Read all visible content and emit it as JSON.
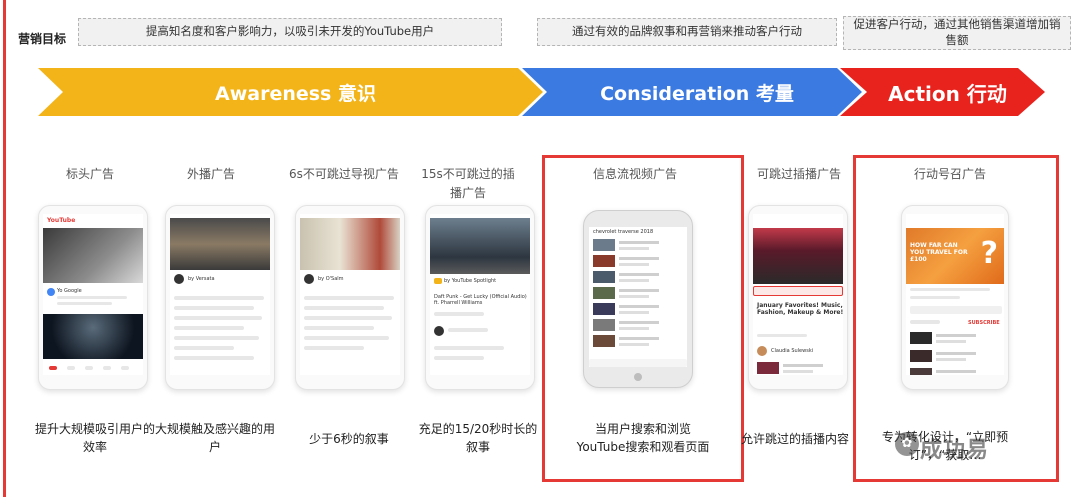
{
  "goals": {
    "label": "营销目标",
    "awareness_goal": "提高知名度和客户影响力，以吸引未开发的YouTube用户",
    "consideration_goal": "通过有效的品牌叙事和再营销来推动客户行动",
    "action_goal": "促进客户行动，通过其他销售渠道增加销售额"
  },
  "stages": {
    "awareness": "Awareness 意识",
    "consideration": "Consideration 考量",
    "action": "Action 行动"
  },
  "columns": [
    {
      "title": "标头广告",
      "caption": "提升大规模吸引用户的效率"
    },
    {
      "title": "外播广告",
      "caption": "大规模触及感兴趣的用户"
    },
    {
      "title": "6s不可跳过导视广告",
      "caption": "少于6秒的叙事"
    },
    {
      "title": "15s不可跳过的插播广告",
      "caption": "充足的15/20秒时长的叙事"
    },
    {
      "title": "信息流视频广告",
      "caption": "当用户搜索和浏览YouTube搜索和观看页面"
    },
    {
      "title": "可跳过插播广告",
      "caption": "允许跳过的插播内容"
    },
    {
      "title": "行动号召广告",
      "caption": "专为转化设计，“立即预订”，“获取…"
    }
  ],
  "mockups": {
    "masthead_brand": "YouTube",
    "masthead_sponsor": "Yo Google",
    "outstream_channel": "by Versata",
    "bumper_channel": "by O'Salm",
    "instream_song": "Daft Punk - Get Lucky (Official Audio) ft. Pharrell Williams",
    "instream_channel": "by YouTube Spotlight",
    "discovery_header": "chevrolet traverse 2018",
    "trueview_title": "January Favorites! Music, Fashion, Makeup & More!",
    "trueview_channel": "Claudia Sulewski",
    "action_headline": "HOW FAR CAN YOU TRAVEL FOR £100",
    "action_subscribe": "SUBSCRIBE"
  },
  "watermark": "成功易",
  "colors": {
    "awareness": "#f3b41a",
    "consideration": "#3b7ae0",
    "action": "#e8231d",
    "highlight_border": "#e53935"
  }
}
